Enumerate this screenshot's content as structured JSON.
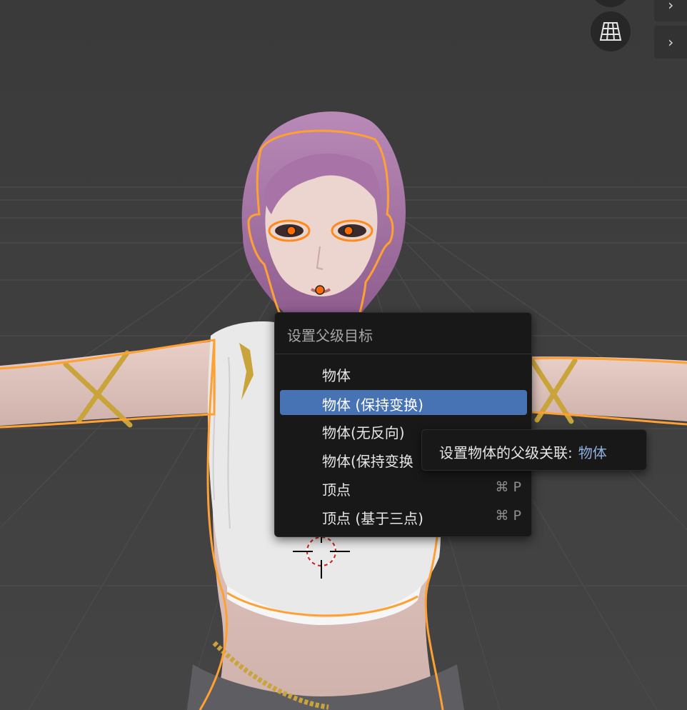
{
  "menu": {
    "title": "设置父级目标",
    "items": [
      {
        "label": "物体",
        "shortcut": "",
        "highlighted": false
      },
      {
        "label": "物体 (保持变换)",
        "shortcut": "",
        "highlighted": true
      },
      {
        "label": "物体(无反向)",
        "shortcut": "",
        "highlighted": false
      },
      {
        "label": "物体(保持变换",
        "shortcut": "",
        "highlighted": false
      },
      {
        "label": "顶点",
        "shortcut": "⌘ P",
        "highlighted": false
      },
      {
        "label": "顶点 (基于三点)",
        "shortcut": "⌘ P",
        "highlighted": false
      }
    ]
  },
  "tooltip": {
    "text": "设置物体的父级关联:",
    "value": "物体"
  },
  "viewport": {
    "nav_icon": "perspective-grid-icon",
    "side_tab_icon": "chevron-right-icon",
    "selection_color": "#ffa033",
    "highlight_color": "#4772b3",
    "background_color": "#3d3d3d"
  }
}
